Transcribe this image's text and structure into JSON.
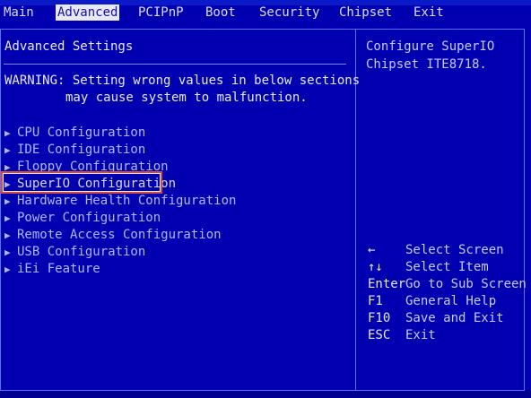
{
  "menu": {
    "items": [
      {
        "label": "Main",
        "active": false
      },
      {
        "label": "Advanced",
        "active": true
      },
      {
        "label": "PCIPnP",
        "active": false
      },
      {
        "label": "Boot",
        "active": false
      },
      {
        "label": "Security",
        "active": false
      },
      {
        "label": "Chipset",
        "active": false
      },
      {
        "label": "Exit",
        "active": false
      }
    ]
  },
  "main": {
    "title": "Advanced Settings",
    "warning_line1": "WARNING: Setting wrong values in below sections",
    "warning_line2": "may cause system to malfunction.",
    "items": [
      {
        "label": "CPU Configuration"
      },
      {
        "label": "IDE Configuration"
      },
      {
        "label": "Floppy Configuration"
      },
      {
        "label": "SuperIO Configuration"
      },
      {
        "label": "Hardware Health Configuration"
      },
      {
        "label": "Power Configuration"
      },
      {
        "label": "Remote Access Configuration"
      },
      {
        "label": "USB Configuration"
      },
      {
        "label": "iEi Feature"
      }
    ],
    "selected_index": 3
  },
  "help": {
    "description_line1": "Configure SuperIO",
    "description_line2": "Chipset ITE8718.",
    "keys": [
      {
        "key": "←",
        "action": "Select Screen"
      },
      {
        "key": "↑↓",
        "action": "Select Item"
      },
      {
        "key": "Enter",
        "action": "Go to Sub Screen"
      },
      {
        "key": "F1",
        "action": "General Help"
      },
      {
        "key": "F10",
        "action": "Save and Exit"
      },
      {
        "key": "ESC",
        "action": "Exit"
      }
    ]
  },
  "colors": {
    "background": "#0000b0",
    "menu_active_bg": "#e8e8ee",
    "item_text": "#aeb8ff",
    "highlight_border": "#d84a3a"
  }
}
